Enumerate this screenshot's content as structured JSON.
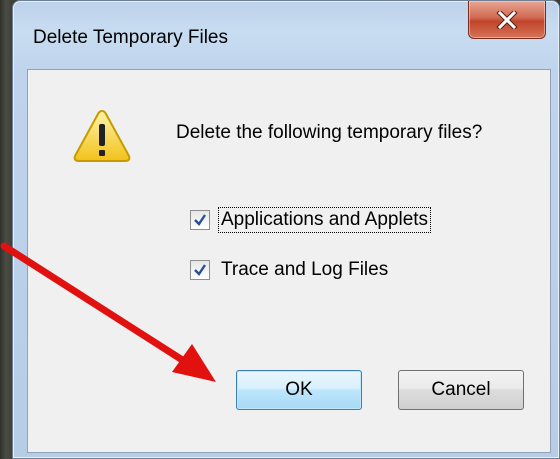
{
  "window": {
    "title": "Delete Temporary Files",
    "close_icon": "close-icon"
  },
  "dialog": {
    "icon": "warning-icon",
    "message": "Delete the following temporary files?",
    "checkboxes": [
      {
        "label": "Applications and Applets",
        "checked": true,
        "focused": true
      },
      {
        "label": "Trace and Log Files",
        "checked": true,
        "focused": false
      }
    ],
    "ok_label": "OK",
    "cancel_label": "Cancel"
  },
  "annotation": {
    "type": "arrow",
    "color": "#e0110f",
    "points_to": "ok-button"
  },
  "colors": {
    "close_button": "#c9553b",
    "ok_button_border": "#3c7fb1",
    "warning_yellow": "#f7d44a"
  }
}
